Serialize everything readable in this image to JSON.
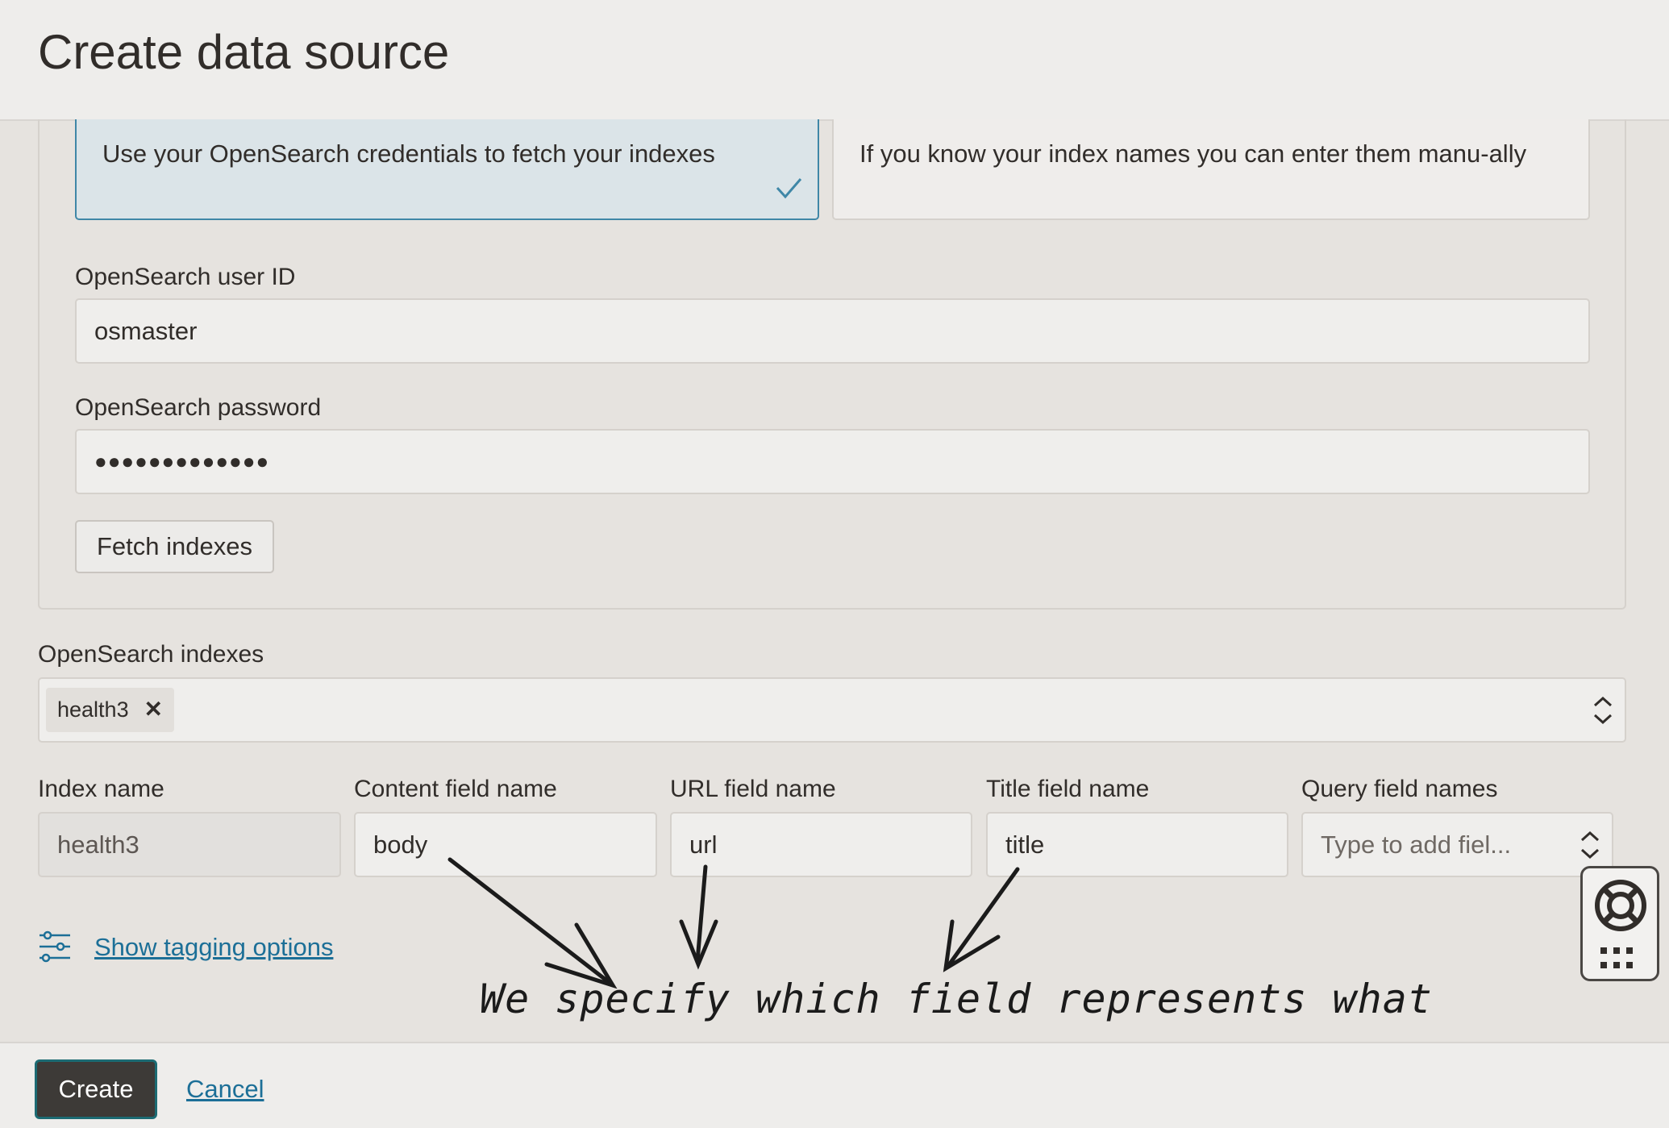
{
  "header": {
    "title": "Create data source"
  },
  "source_options": {
    "fetch": {
      "label": "Use your OpenSearch credentials to fetch your indexes",
      "selected": true
    },
    "manual": {
      "label": "If you know your index names you can enter them manu-ally"
    }
  },
  "credentials": {
    "user_id_label": "OpenSearch user ID",
    "user_id_value": "osmaster",
    "password_label": "OpenSearch password",
    "password_value": "●●●●●●●●●●●●●",
    "fetch_button": "Fetch indexes"
  },
  "indexes": {
    "label": "OpenSearch indexes",
    "selected_chip": "health3"
  },
  "fields": {
    "index_name": {
      "label": "Index name",
      "value": "health3"
    },
    "content_field": {
      "label": "Content field name",
      "value": "body"
    },
    "url_field": {
      "label": "URL field name",
      "value": "url"
    },
    "title_field": {
      "label": "Title field name",
      "value": "title"
    },
    "query_fields": {
      "label": "Query field names",
      "placeholder": "Type to add fiel..."
    }
  },
  "tagging": {
    "link": "Show tagging options"
  },
  "annotation": "We specify which field represents what",
  "footer": {
    "create": "Create",
    "cancel": "Cancel"
  },
  "icons": [
    "checkmark-icon",
    "chevron-updown-icon",
    "remove-icon",
    "sliders-icon",
    "lifebuoy-icon",
    "grid-dots-icon"
  ],
  "colors": {
    "accent": "#3f87a7",
    "link": "#1c6f97",
    "primary_button": "#3d3a37"
  }
}
